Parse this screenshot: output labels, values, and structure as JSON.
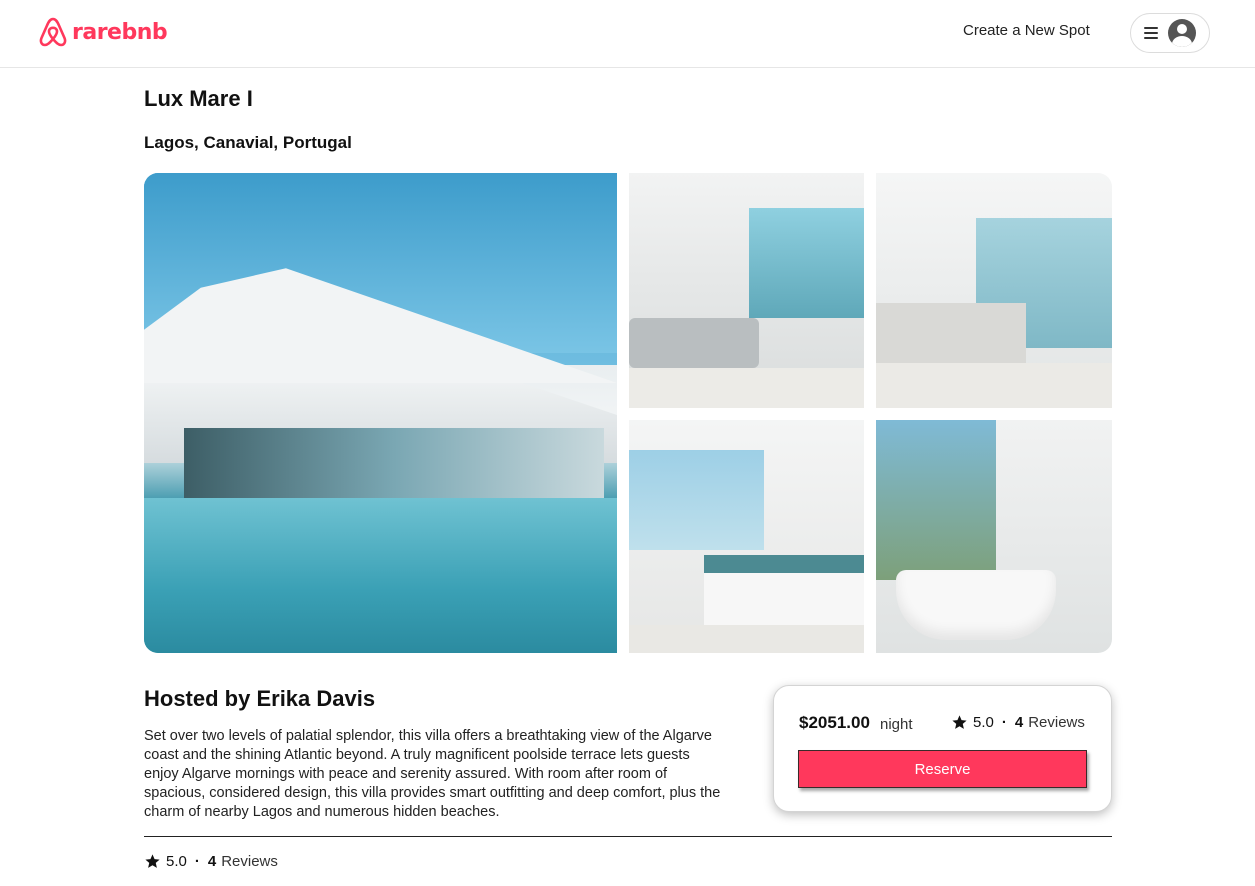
{
  "header": {
    "logo_text": "rarebnb",
    "create_spot_label": "Create a New Spot",
    "brand_color": "#ff385c"
  },
  "spot": {
    "title": "Lux Mare I",
    "location": "Lagos, Canavial, Portugal"
  },
  "gallery": {
    "images": [
      {
        "alt": "villa-exterior-pool"
      },
      {
        "alt": "living-room"
      },
      {
        "alt": "kitchen"
      },
      {
        "alt": "bedroom"
      },
      {
        "alt": "bathroom"
      }
    ]
  },
  "host": {
    "heading": "Hosted by Erika Davis",
    "description": "Set over two levels of palatial splendor, this villa offers a breathtaking view of the Algarve coast and the shining Atlantic beyond. A truly magnificent poolside terrace lets guests enjoy Algarve mornings with peace and serenity assured. With room after room of spacious, considered design, this villa provides smart outfitting and deep comfort, plus the charm of nearby Lagos and numerous hidden beaches."
  },
  "booking": {
    "price": "$2051.00",
    "price_unit": "night",
    "rating": "5.0",
    "separator": "·",
    "review_count": "4",
    "reviews_label": "Reviews",
    "reserve_label": "Reserve"
  },
  "reviews_summary": {
    "rating": "5.0",
    "separator": "·",
    "review_count": "4",
    "reviews_label": "Reviews"
  },
  "icons": {
    "logo": "airbnb-logo-icon",
    "menu": "hamburger-menu-icon",
    "user": "user-avatar-icon",
    "star": "star-icon"
  }
}
